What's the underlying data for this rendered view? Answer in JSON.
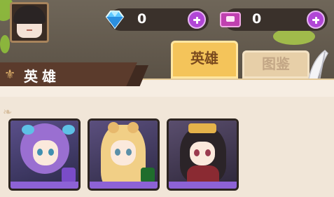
{
  "resources": [
    {
      "name": "diamond",
      "icon": "diamond-icon",
      "value": "0"
    },
    {
      "name": "summon-ticket",
      "icon": "ticket-icon",
      "value": "0"
    }
  ],
  "tabs": [
    {
      "label": "英雄",
      "active": true
    },
    {
      "label": "图鉴",
      "active": false
    }
  ],
  "section": {
    "title": "英雄"
  },
  "heroes": [
    {
      "name": "purple-hair-fairy",
      "element_color": "#7a4cc8"
    },
    {
      "name": "cat-ear-blonde",
      "element_color": "#1f6d2c"
    },
    {
      "name": "crowned-dark-hair",
      "element_color": "#7a2a2a"
    }
  ],
  "colors": {
    "accent_plus": "#b146d6",
    "tab_active": "#f4c45a",
    "tab_inactive": "#e7cfa8",
    "ribbon": "#5b3b2c"
  }
}
